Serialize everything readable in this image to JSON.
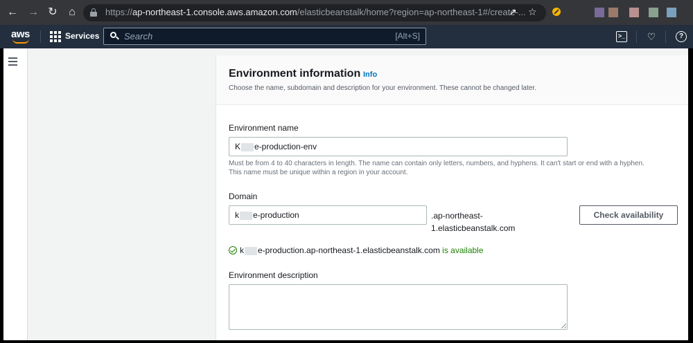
{
  "browser": {
    "url_prefix": "https://",
    "url_host": "ap-northeast-1.console.aws.amazon.com",
    "url_path": "/elasticbeanstalk/home?region=ap-northeast-1#/create-..."
  },
  "aws_nav": {
    "logo_text": "aws",
    "services_label": "Services",
    "search_placeholder": "Search",
    "search_shortcut": "[Alt+S]"
  },
  "panel": {
    "title": "Environment information",
    "info_link": "Info",
    "description": "Choose the name, subdomain and description for your environment. These cannot be changed later."
  },
  "environment_name": {
    "label": "Environment name",
    "value_prefix": "K",
    "value_suffix": "e-production-env",
    "hint_line1": "Must be from 4 to 40 characters in length. The name can contain only letters, numbers, and hyphens. It can't start or end with a hyphen.",
    "hint_line2": "This name must be unique within a region in your account."
  },
  "domain": {
    "label": "Domain",
    "value_prefix": "k",
    "value_suffix": "e-production",
    "suffix_line1": ".ap-northeast-",
    "suffix_line2": "1.elasticbeanstalk.com",
    "check_button": "Check availability",
    "availability_prefix": "k",
    "availability_domain": "e-production.ap-northeast-1.elasticbeanstalk.com",
    "availability_status": "is available"
  },
  "environment_description": {
    "label": "Environment description",
    "value": ""
  },
  "colors": {
    "aws_nav_bg": "#232f3e",
    "link_blue": "#0073bb",
    "success_green": "#1d8102"
  }
}
